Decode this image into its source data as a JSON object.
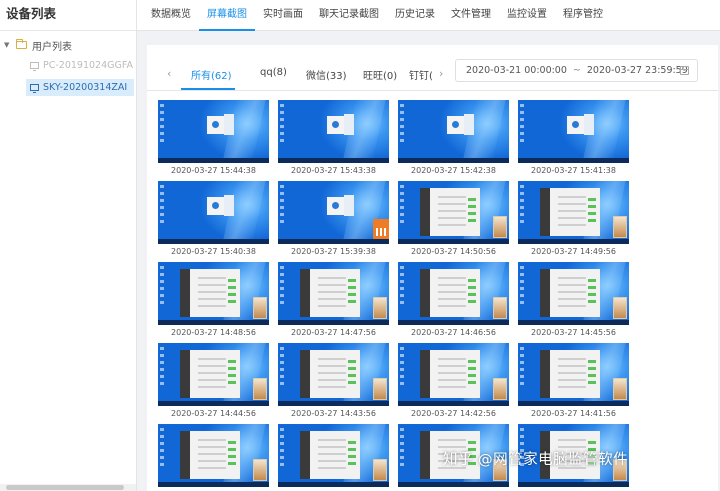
{
  "left_panel": {
    "title": "设备列表",
    "root": "用户列表",
    "devices": [
      {
        "name": "PC-20191024GGFA",
        "online": false
      },
      {
        "name": "SKY-20200314ZAI",
        "online": true
      }
    ]
  },
  "nav": {
    "items": [
      "数据概览",
      "屏幕截图",
      "实时画面",
      "聊天记录截图",
      "历史记录",
      "文件管理",
      "监控设置",
      "程序管控"
    ],
    "active": "屏幕截图"
  },
  "subtabs": {
    "items": [
      "所有(62)",
      "qq(8)",
      "微信(33)",
      "旺旺(0)",
      "钉钉("
    ],
    "active": "所有(62)"
  },
  "daterange": {
    "start": "2020-03-21 00:00:00",
    "separator": "~",
    "end": "2020-03-27 23:59:59"
  },
  "screenshots": [
    {
      "time": "2020-03-27 15:44:38",
      "kind": "dialog"
    },
    {
      "time": "2020-03-27 15:43:38",
      "kind": "dialog"
    },
    {
      "time": "2020-03-27 15:42:38",
      "kind": "dialog"
    },
    {
      "time": "2020-03-27 15:41:38",
      "kind": "dialog"
    },
    {
      "time": "2020-03-27 15:40:38",
      "kind": "dialog"
    },
    {
      "time": "2020-03-27 15:39:38",
      "kind": "dialog-orange"
    },
    {
      "time": "2020-03-27 14:50:56",
      "kind": "chat"
    },
    {
      "time": "2020-03-27 14:49:56",
      "kind": "chat"
    },
    {
      "time": "2020-03-27 14:48:56",
      "kind": "chat"
    },
    {
      "time": "2020-03-27 14:47:56",
      "kind": "chat"
    },
    {
      "time": "2020-03-27 14:46:56",
      "kind": "chat"
    },
    {
      "time": "2020-03-27 14:45:56",
      "kind": "chat"
    },
    {
      "time": "2020-03-27 14:44:56",
      "kind": "chat"
    },
    {
      "time": "2020-03-27 14:43:56",
      "kind": "chat"
    },
    {
      "time": "2020-03-27 14:42:56",
      "kind": "chat"
    },
    {
      "time": "2020-03-27 14:41:56",
      "kind": "chat"
    },
    {
      "time": "",
      "kind": "chat"
    },
    {
      "time": "",
      "kind": "chat"
    },
    {
      "time": "",
      "kind": "chat"
    },
    {
      "time": "",
      "kind": "chat"
    }
  ],
  "watermark": "知乎 @网管家电脑监管软件",
  "colors": {
    "accent": "#1a8fe8",
    "desktop": "#1167d6"
  }
}
